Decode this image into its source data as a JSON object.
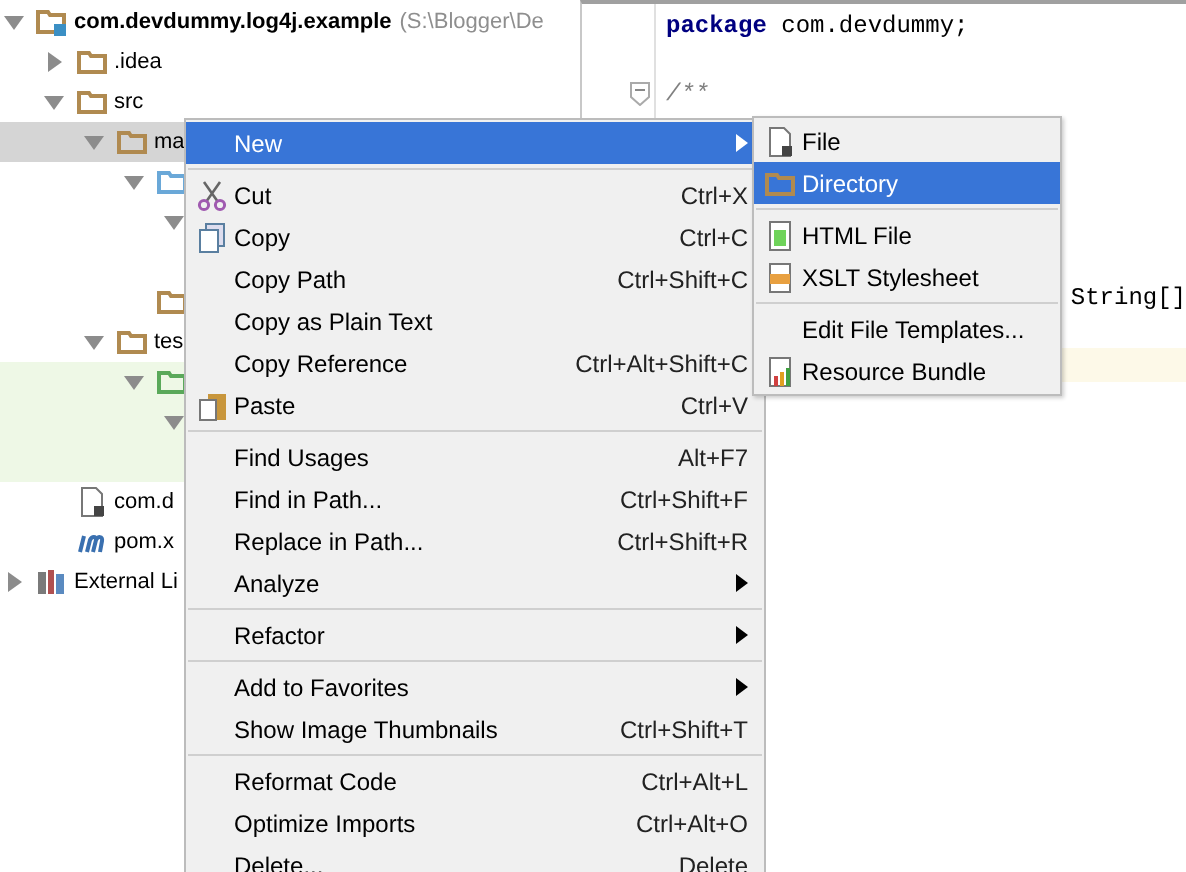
{
  "project_tree": {
    "nodes": [
      {
        "kind": "module",
        "label": "com.devdummy.log4j.example",
        "hint": "(S:\\Blogger\\De",
        "expanded": true,
        "children": [
          {
            "kind": "folder",
            "label": ".idea",
            "expanded": false
          },
          {
            "kind": "folder",
            "label": "src",
            "expanded": true,
            "children": [
              {
                "kind": "folder",
                "label": "ma",
                "expanded": true,
                "selected": true,
                "children": [
                  {
                    "kind": "source-folder",
                    "expanded": true,
                    "children": [
                      {
                        "expanded": true
                      }
                    ]
                  },
                  {
                    "kind": "folder"
                  }
                ]
              },
              {
                "kind": "folder",
                "label": "tes",
                "expanded": true,
                "children": [
                  {
                    "kind": "test-folder",
                    "expanded": true,
                    "highlighted": true,
                    "children": [
                      {
                        "expanded": true,
                        "highlighted": true
                      }
                    ]
                  }
                ]
              }
            ]
          },
          {
            "kind": "file",
            "label": "com.d"
          },
          {
            "kind": "maven",
            "label": "pom.x"
          }
        ]
      },
      {
        "kind": "library",
        "label": "External Li",
        "expanded": false
      }
    ]
  },
  "editor": {
    "lines": [
      {
        "kind": "keyword-line",
        "keyword": "package",
        "text": "com.devdummy;"
      },
      {
        "kind": "blank"
      },
      {
        "kind": "comment",
        "text": "/**",
        "fold": true
      },
      {
        "kind": "blank"
      },
      {
        "kind": "blank"
      },
      {
        "kind": "blank"
      },
      {
        "kind": "blank"
      },
      {
        "kind": "blank"
      },
      {
        "kind": "code-right",
        "text": "String[]"
      },
      {
        "kind": "blank"
      },
      {
        "kind": "current"
      }
    ]
  },
  "context_menu": {
    "items": [
      {
        "kind": "plain",
        "label": "New",
        "submenu": true,
        "selected": true
      },
      {
        "kind": "separator"
      },
      {
        "kind": "scissors",
        "label": "Cut",
        "shortcut": "Ctrl+X",
        "selected": false
      },
      {
        "kind": "copy",
        "label": "Copy",
        "shortcut": "Ctrl+C",
        "selected": false
      },
      {
        "kind": "plain",
        "label": "Copy Path",
        "shortcut": "Ctrl+Shift+C",
        "selected": false
      },
      {
        "kind": "plain",
        "label": "Copy as Plain Text",
        "selected": false
      },
      {
        "kind": "plain",
        "label": "Copy Reference",
        "shortcut": "Ctrl+Alt+Shift+C",
        "selected": false
      },
      {
        "kind": "paste",
        "label": "Paste",
        "shortcut": "Ctrl+V",
        "selected": false
      },
      {
        "kind": "separator"
      },
      {
        "kind": "plain",
        "label": "Find Usages",
        "shortcut": "Alt+F7",
        "selected": false
      },
      {
        "kind": "plain",
        "label": "Find in Path...",
        "shortcut": "Ctrl+Shift+F",
        "selected": false
      },
      {
        "kind": "plain",
        "label": "Replace in Path...",
        "shortcut": "Ctrl+Shift+R",
        "selected": false
      },
      {
        "kind": "plain",
        "label": "Analyze",
        "submenu": true,
        "selected": false
      },
      {
        "kind": "separator"
      },
      {
        "kind": "plain",
        "label": "Refactor",
        "submenu": true,
        "selected": false
      },
      {
        "kind": "separator"
      },
      {
        "kind": "plain",
        "label": "Add to Favorites",
        "submenu": true,
        "selected": false
      },
      {
        "kind": "plain",
        "label": "Show Image Thumbnails",
        "shortcut": "Ctrl+Shift+T",
        "selected": false
      },
      {
        "kind": "separator"
      },
      {
        "kind": "plain",
        "label": "Reformat Code",
        "shortcut": "Ctrl+Alt+L",
        "selected": false
      },
      {
        "kind": "plain",
        "label": "Optimize Imports",
        "shortcut": "Ctrl+Alt+O",
        "selected": false
      },
      {
        "kind": "plain",
        "label": "Delete...",
        "shortcut": "Delete",
        "selected": false
      }
    ]
  },
  "submenu": {
    "items": [
      {
        "kind": "file",
        "label": "File",
        "selected": false
      },
      {
        "kind": "folder",
        "label": "Directory",
        "selected": true
      },
      {
        "kind": "separator"
      },
      {
        "kind": "html",
        "label": "HTML File",
        "selected": false
      },
      {
        "kind": "xslt",
        "label": "XSLT Stylesheet",
        "selected": false
      },
      {
        "kind": "separator"
      },
      {
        "kind": "plain",
        "label": "Edit File Templates...",
        "selected": false
      },
      {
        "kind": "bundle",
        "label": "Resource Bundle",
        "selected": false
      }
    ]
  }
}
